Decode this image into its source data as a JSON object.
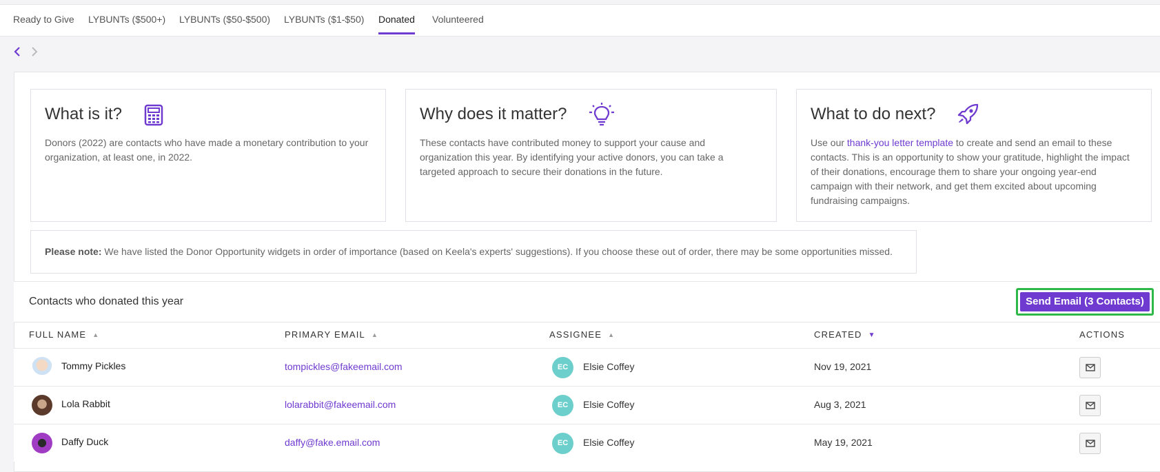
{
  "tabs": [
    {
      "label": "Ready to Give"
    },
    {
      "label": "LYBUNTs ($500+)"
    },
    {
      "label": "LYBUNTs ($50-$500)"
    },
    {
      "label": "LYBUNTs ($1-$50)"
    },
    {
      "label": "Donated",
      "active": true
    },
    {
      "label": "Volunteered"
    }
  ],
  "cards": [
    {
      "title": "What is it?",
      "icon": "calculator-icon",
      "body": "Donors (2022) are contacts who have made a monetary contribution to your organization, at least one, in 2022."
    },
    {
      "title": "Why does it matter?",
      "icon": "lightbulb-icon",
      "body": "These contacts have contributed money to support your cause and organization this year. By identifying your active donors, you can take a targeted approach to secure their donations in the future."
    },
    {
      "title": "What to do next?",
      "icon": "rocket-icon",
      "body_prefix": "Use our ",
      "link_text": "thank-you letter template",
      "body_suffix": " to create and send an email to these contacts. This is an opportunity to show your gratitude, highlight the impact of their donations, encourage them to share your ongoing year-end campaign with their network, and get them excited about upcoming fundraising campaigns."
    }
  ],
  "note": {
    "label": "Please note:",
    "text": " We have listed the Donor Opportunity widgets in order of importance (based on Keela's experts' suggestions). If you choose these out of order, there may be some opportunities missed."
  },
  "section": {
    "title": "Contacts who donated this year",
    "send_button": "Send Email (3 Contacts)"
  },
  "table": {
    "headers": [
      "FULL NAME",
      "PRIMARY EMAIL",
      "ASSIGNEE",
      "CREATED",
      "ACTIONS"
    ],
    "sorted_column": "CREATED",
    "rows": [
      {
        "name": "Tommy Pickles",
        "email": "tompickles@fakeemail.com",
        "assignee_initials": "EC",
        "assignee": "Elsie Coffey",
        "created": "Nov 19, 2021"
      },
      {
        "name": "Lola Rabbit",
        "email": "lolarabbit@fakeemail.com",
        "assignee_initials": "EC",
        "assignee": "Elsie Coffey",
        "created": "Aug 3, 2021"
      },
      {
        "name": "Daffy Duck",
        "email": "daffy@fake.email.com",
        "assignee_initials": "EC",
        "assignee": "Elsie Coffey",
        "created": "May 19, 2021"
      }
    ]
  },
  "colors": {
    "accent": "#6f3ad0",
    "highlight": "#2fb84a",
    "assignee_avatar": "#6dcfcc"
  }
}
